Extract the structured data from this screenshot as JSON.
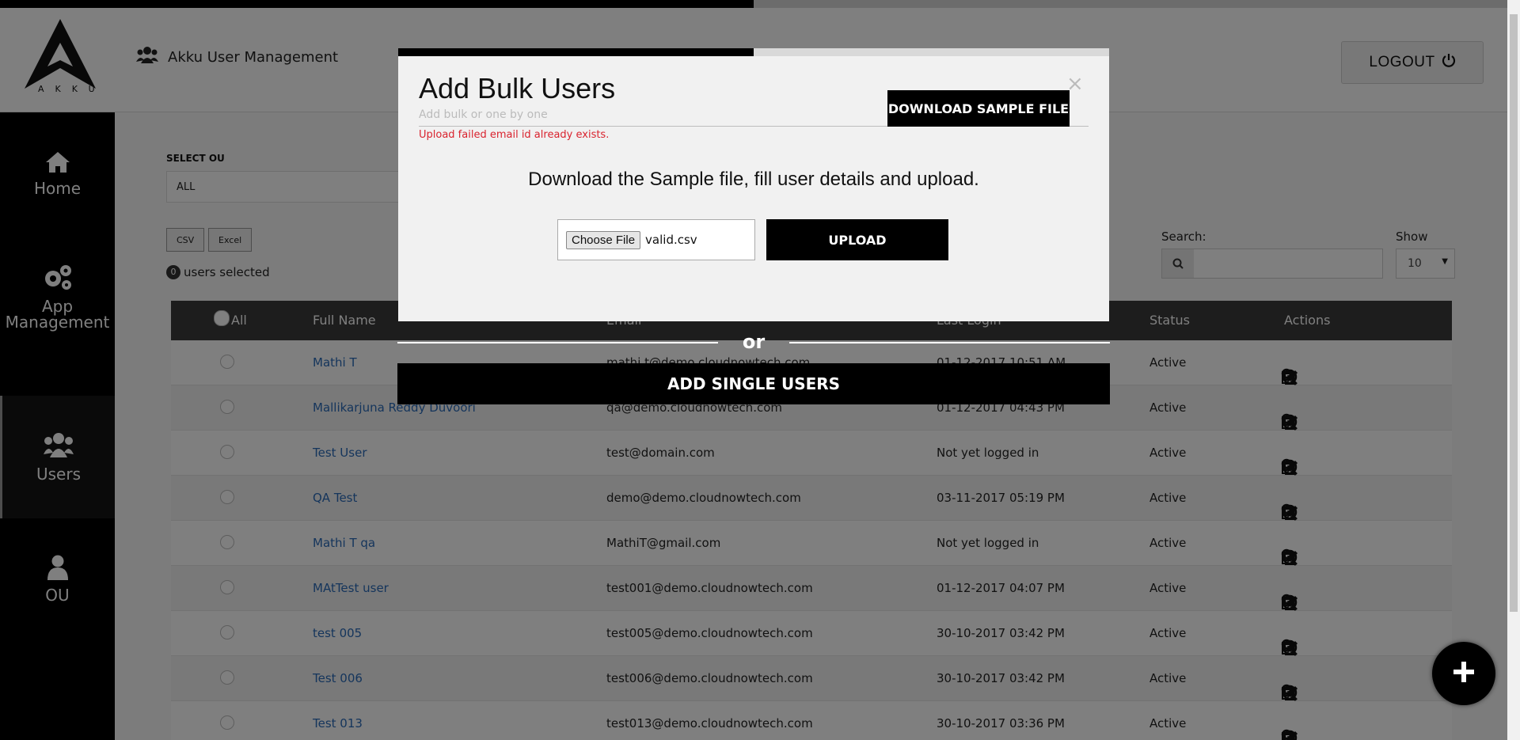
{
  "header": {
    "logo_text": "AKKU",
    "app_title": "Akku User Management",
    "logout_label": "LOGOUT"
  },
  "sidebar": {
    "items": [
      {
        "label": "Home",
        "icon": "home-icon"
      },
      {
        "label": "App Management",
        "icon": "gears-icon"
      },
      {
        "label": "Users",
        "icon": "users-icon",
        "active": true
      },
      {
        "label": "OU",
        "icon": "user-icon"
      }
    ]
  },
  "filters": {
    "ou_label": "SELECT OU",
    "ou_value": "ALL",
    "csv_label": "CSV",
    "excel_label": "Excel",
    "selected_count": "0",
    "selected_text": "users selected",
    "search_label": "Search:",
    "show_label": "Show",
    "show_value": "10"
  },
  "table": {
    "headers": {
      "all": "All",
      "full_name": "Full Name",
      "email": "Email",
      "last_login": "Last Login",
      "status": "Status",
      "actions": "Actions"
    },
    "rows": [
      {
        "name": "Mathi T",
        "email": "mathi.t@demo.cloudnowtech.com",
        "last_login": "01-12-2017 10:51 AM",
        "status": "Active"
      },
      {
        "name": "Mallikarjuna Reddy Duvoori",
        "email": "qa@demo.cloudnowtech.com",
        "last_login": "01-12-2017 04:43 PM",
        "status": "Active"
      },
      {
        "name": "Test User",
        "email": "test@domain.com",
        "last_login": "Not yet logged in",
        "status": "Active"
      },
      {
        "name": "QA Test",
        "email": "demo@demo.cloudnowtech.com",
        "last_login": "03-11-2017 05:19 PM",
        "status": "Active"
      },
      {
        "name": "Mathi T qa",
        "email": "MathiT@gmail.com",
        "last_login": "Not yet logged in",
        "status": "Active"
      },
      {
        "name": "MAtTest user",
        "email": "test001@demo.cloudnowtech.com",
        "last_login": "01-12-2017 04:07 PM",
        "status": "Active"
      },
      {
        "name": "test 005",
        "email": "test005@demo.cloudnowtech.com",
        "last_login": "30-10-2017 03:42 PM",
        "status": "Active"
      },
      {
        "name": "Test 006",
        "email": "test006@demo.cloudnowtech.com",
        "last_login": "30-10-2017 03:42 PM",
        "status": "Active"
      },
      {
        "name": "Test 013",
        "email": "test013@demo.cloudnowtech.com",
        "last_login": "30-10-2017 03:36 PM",
        "status": "Active"
      }
    ]
  },
  "modal": {
    "title": "Add Bulk Users",
    "subtitle": "Add bulk or one by one",
    "error": "Upload failed email id already exists.",
    "close": "×",
    "download_label": "DOWNLOAD SAMPLE FILE",
    "instruction": "Download the Sample file, fill user details and upload.",
    "choose_file_label": "Choose File",
    "file_name": "valid.csv",
    "upload_label": "UPLOAD",
    "or_text": "or",
    "single_label": "ADD SINGLE USERS"
  },
  "fab": {
    "icon": "plus-icon"
  },
  "colors": {
    "accent": "#000000",
    "link": "#2a6bb8",
    "error": "#d9232e"
  }
}
